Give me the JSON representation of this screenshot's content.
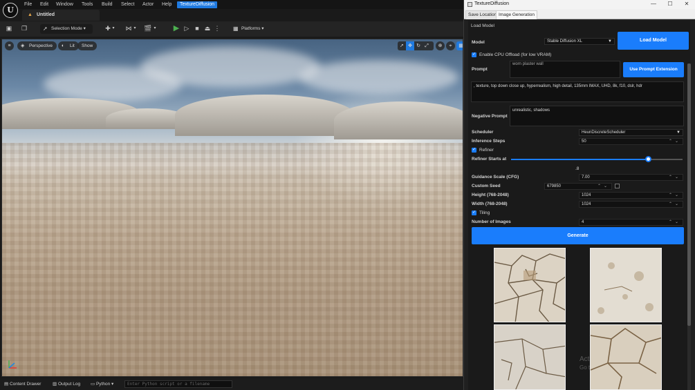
{
  "ue": {
    "logo": "U",
    "menu": [
      "File",
      "Edit",
      "Window",
      "Tools",
      "Build",
      "Select",
      "Actor",
      "Help",
      "TextureDiffusion"
    ],
    "doc_tab": "Untitled",
    "toolbar": {
      "selection_mode": "Selection Mode",
      "platforms": "Platforms"
    },
    "viewport": {
      "perspective": "Perspective",
      "lit": "Lit",
      "show": "Show"
    },
    "status": {
      "content_drawer": "Content Drawer",
      "output_log": "Output Log",
      "python": "Python",
      "cmd_placeholder": "Enter Python script or a filename"
    }
  },
  "td": {
    "window_title": "TextureDiffusion",
    "tabs": [
      "Save Location",
      "Image Generation"
    ],
    "load_model_group": "Load Model",
    "model_label": "Model",
    "model_value": "Stable Diffusion XL",
    "load_model_button": "Load Model",
    "cpu_offload": "Enable CPU Offload (for low VRAM)",
    "prompt_label": "Prompt",
    "prompt_top": "worn plaster wall",
    "prompt_extension_button": "Use Prompt Extension",
    "prompt_extension_text": ", texture, top down close up, hyperrealism, high detail, 135mm IMAX, UHD, 8k, f10, dslr, hdr",
    "negative_label": "Negative Prompt",
    "negative_value": "unrealistic, shadows",
    "scheduler_label": "Scheduler",
    "scheduler_value": "HeunDiscreteScheduler",
    "steps_label": "Inference Steps",
    "steps_value": "50",
    "refiner_label": "Refiner",
    "refiner_starts_label": "Refiner Starts at",
    "refiner_starts_value": ".8",
    "refiner_starts_fraction": 0.8,
    "cfg_label": "Guidance Scale (CFG)",
    "cfg_value": "7.00",
    "seed_label": "Custom Seed",
    "seed_value": "679850",
    "height_label": "Height (768-2048)",
    "height_value": "1024",
    "width_label": "Width (768-2048)",
    "width_value": "1024",
    "tiling_label": "Tiling",
    "num_images_label": "Number of Images",
    "num_images_value": "4",
    "generate_button": "Generate",
    "watermark_1": "Act",
    "watermark_2": "Go t"
  },
  "colors": {
    "accent": "#1a7dfc",
    "menu_active": "#1f7ae0"
  }
}
